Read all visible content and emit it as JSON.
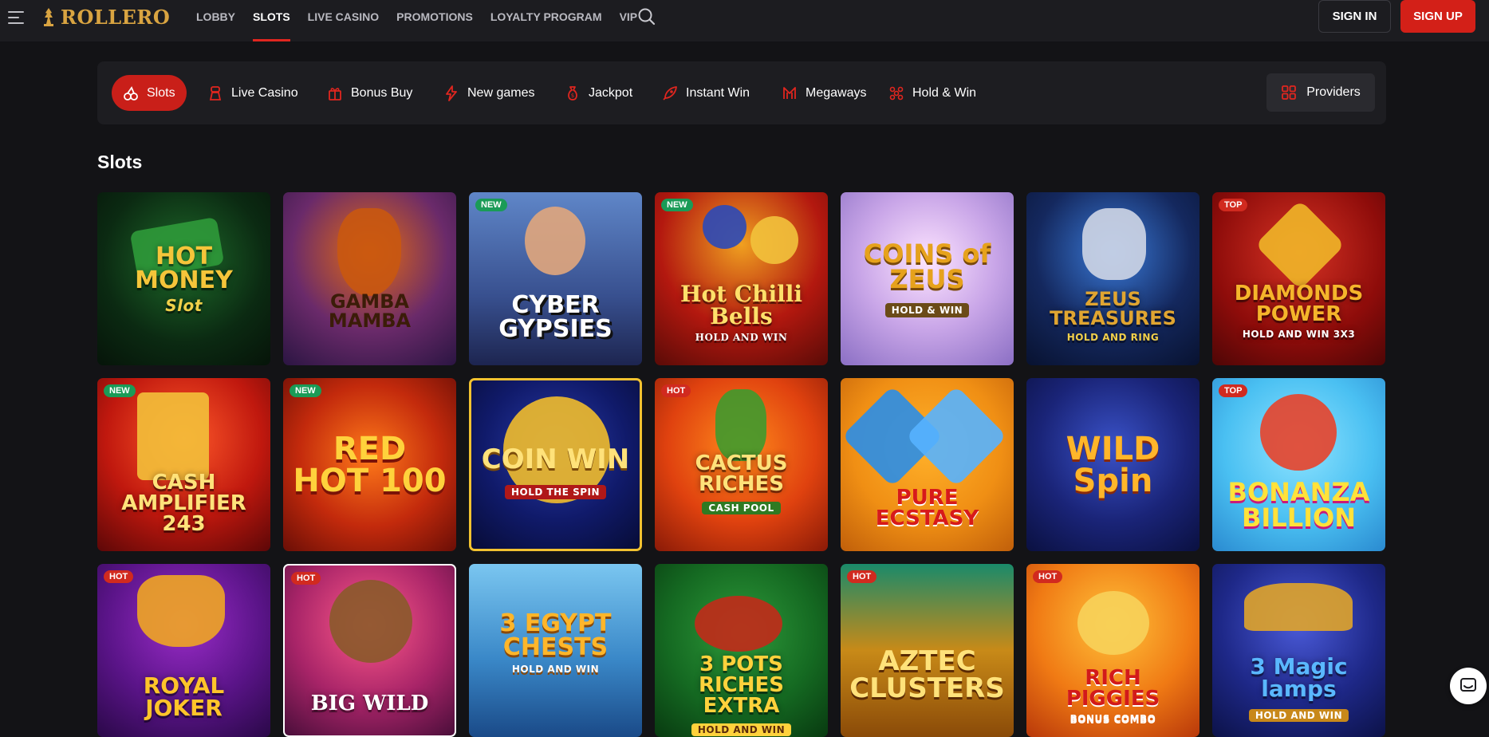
{
  "header": {
    "logo_text": "ROLLERO",
    "nav": [
      {
        "label": "LOBBY",
        "active": false
      },
      {
        "label": "SLOTS",
        "active": true
      },
      {
        "label": "LIVE CASINO",
        "active": false
      },
      {
        "label": "PROMOTIONS",
        "active": false
      },
      {
        "label": "LOYALTY PROGRAM",
        "active": false
      },
      {
        "label": "VIP",
        "active": false
      }
    ],
    "signin_label": "SIGN IN",
    "signup_label": "SIGN UP"
  },
  "categories": [
    {
      "label": "Slots",
      "icon": "cherries-icon",
      "active": true
    },
    {
      "label": "Live Casino",
      "icon": "dealer-icon",
      "active": false
    },
    {
      "label": "Bonus Buy",
      "icon": "gift-icon",
      "active": false
    },
    {
      "label": "New games",
      "icon": "lightning-icon",
      "active": false
    },
    {
      "label": "Jackpot",
      "icon": "money-bag-icon",
      "active": false
    },
    {
      "label": "Instant Win",
      "icon": "rocket-icon",
      "active": false
    },
    {
      "label": "Megaways",
      "icon": "megaways-icon",
      "active": false
    },
    {
      "label": "Hold & Win",
      "icon": "hold-win-icon",
      "active": false
    }
  ],
  "providers_label": "Providers",
  "section_title": "Slots",
  "games": [
    {
      "title": "HOT MONEY",
      "subtitle": "Slot",
      "badge": ""
    },
    {
      "title": "GAMBA MAMBA",
      "subtitle": "",
      "badge": ""
    },
    {
      "title": "CYBER GYPSIES",
      "subtitle": "",
      "badge": "NEW"
    },
    {
      "title": "Hot Chilli Bells",
      "subtitle": "HOLD AND WIN",
      "badge": "NEW"
    },
    {
      "title": "COINS of ZEUS",
      "subtitle": "HOLD & WIN",
      "badge": ""
    },
    {
      "title": "ZEUS TREASURES",
      "subtitle": "HOLD AND RING",
      "badge": ""
    },
    {
      "title": "DIAMONDS POWER",
      "subtitle": "HOLD AND WIN 3X3",
      "badge": "TOP"
    },
    {
      "title": "CASH AMPLIFIER 243",
      "subtitle": "",
      "badge": "NEW"
    },
    {
      "title": "RED HOT 100",
      "subtitle": "",
      "badge": "NEW"
    },
    {
      "title": "COIN WIN",
      "subtitle": "HOLD THE SPIN",
      "badge": ""
    },
    {
      "title": "CACTUS RICHES",
      "subtitle": "CASH POOL",
      "badge": "HOT"
    },
    {
      "title": "PURE ECSTASY",
      "subtitle": "",
      "badge": ""
    },
    {
      "title": "WILD Spin",
      "subtitle": "",
      "badge": ""
    },
    {
      "title": "BONANZA BILLION",
      "subtitle": "",
      "badge": "TOP"
    },
    {
      "title": "ROYAL JOKER",
      "subtitle": "",
      "badge": "HOT"
    },
    {
      "title": "BIG WILD",
      "subtitle": "",
      "badge": "HOT"
    },
    {
      "title": "3 EGYPT CHESTS",
      "subtitle": "HOLD AND WIN",
      "badge": ""
    },
    {
      "title": "3 POTS RICHES EXTRA",
      "subtitle": "HOLD AND WIN",
      "badge": ""
    },
    {
      "title": "AZTEC CLUSTERS",
      "subtitle": "",
      "badge": "HOT"
    },
    {
      "title": "RICH PIGGIES",
      "subtitle": "BONUS COMBO",
      "badge": "HOT"
    },
    {
      "title": "3 Magic lamps",
      "subtitle": "HOLD AND WIN",
      "badge": ""
    }
  ]
}
